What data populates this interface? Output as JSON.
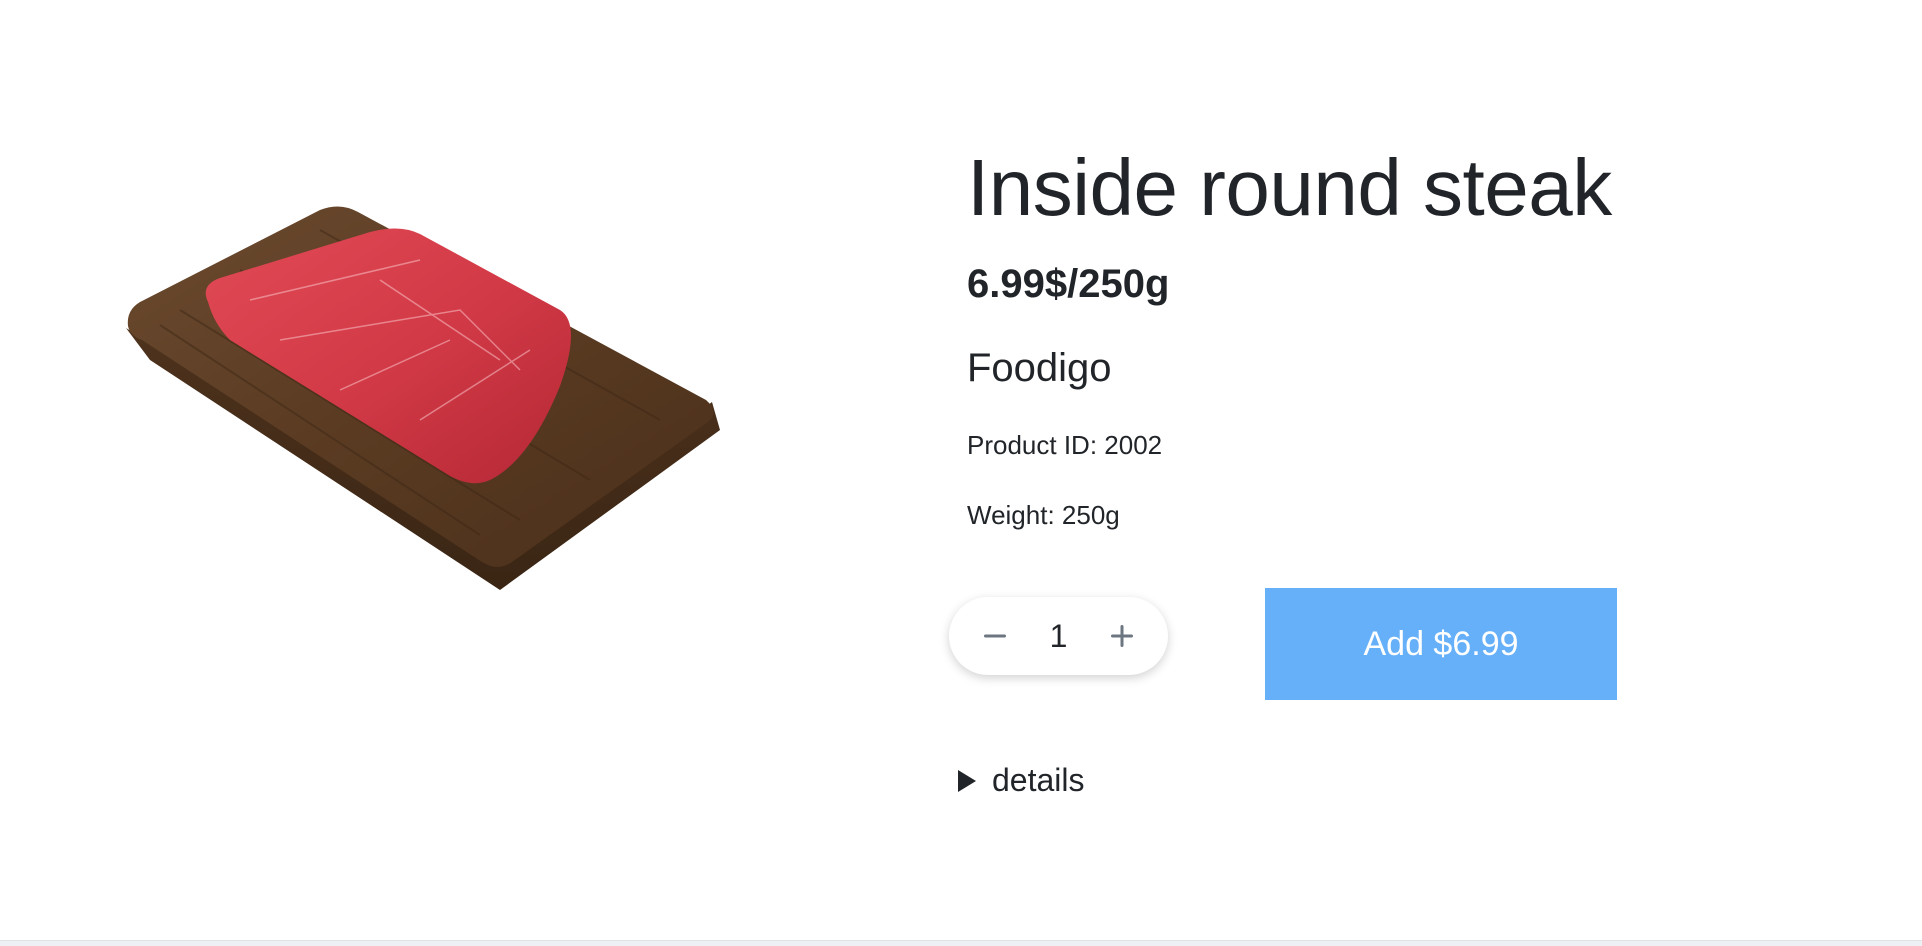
{
  "product": {
    "title": "Inside round steak",
    "unit_price": "6.99$/250g",
    "brand": "Foodigo",
    "product_id": "Product ID: 2002",
    "weight": "Weight: 250g",
    "image_icon": "steak-on-cutting-board"
  },
  "cart": {
    "quantity": "1",
    "decrement_icon": "minus-icon",
    "increment_icon": "plus-icon",
    "add_label": "Add $6.99"
  },
  "details": {
    "label": "details"
  },
  "colors": {
    "accent": "#66b0fa",
    "text": "#212529"
  }
}
